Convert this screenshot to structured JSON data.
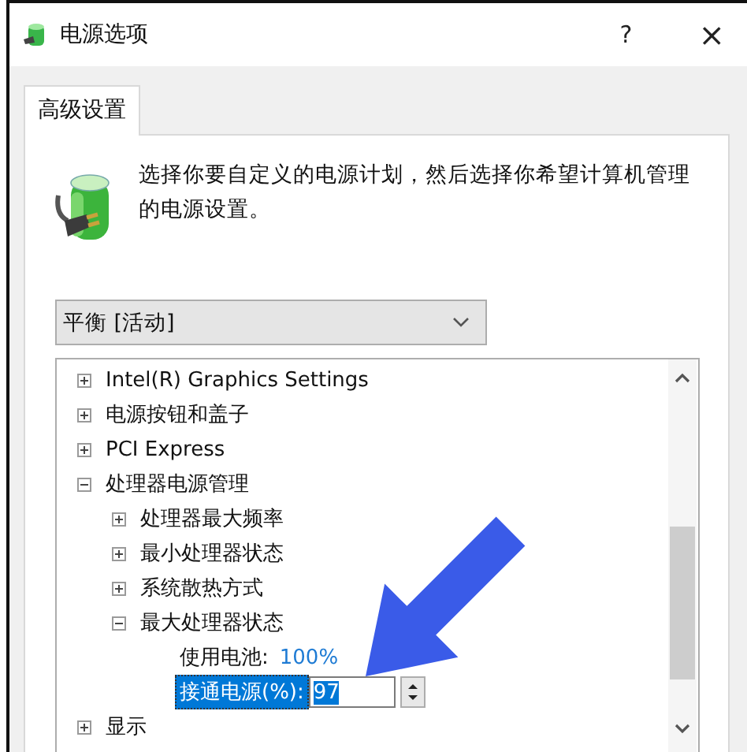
{
  "window": {
    "title": "电源选项",
    "help": "?",
    "close": "×"
  },
  "tabs": [
    {
      "label": "高级设置",
      "selected": true
    }
  ],
  "description": "选择你要自定义的电源计划，然后选择你希望计算机管理的电源设置。",
  "plan_dropdown": {
    "value": "平衡 [活动]"
  },
  "settings_tree": [
    {
      "kind": "group",
      "label": "Intel(R) Graphics Settings",
      "expanded": false
    },
    {
      "kind": "group",
      "label": "电源按钮和盖子",
      "expanded": false
    },
    {
      "kind": "group",
      "label": "PCI Express",
      "expanded": false
    },
    {
      "kind": "group",
      "label": "处理器电源管理",
      "expanded": true,
      "children": [
        {
          "kind": "group",
          "label": "处理器最大频率",
          "expanded": false
        },
        {
          "kind": "group",
          "label": "最小处理器状态",
          "expanded": false
        },
        {
          "kind": "group",
          "label": "系统散热方式",
          "expanded": false
        },
        {
          "kind": "group",
          "label": "最大处理器状态",
          "expanded": true,
          "children": [
            {
              "kind": "value",
              "label": "使用电池:",
              "value": "100%",
              "selected": false
            },
            {
              "kind": "spin",
              "label": "接通电源(%):",
              "value": "97",
              "selected": true
            }
          ]
        }
      ]
    },
    {
      "kind": "group",
      "label": "显示",
      "expanded": false
    }
  ]
}
